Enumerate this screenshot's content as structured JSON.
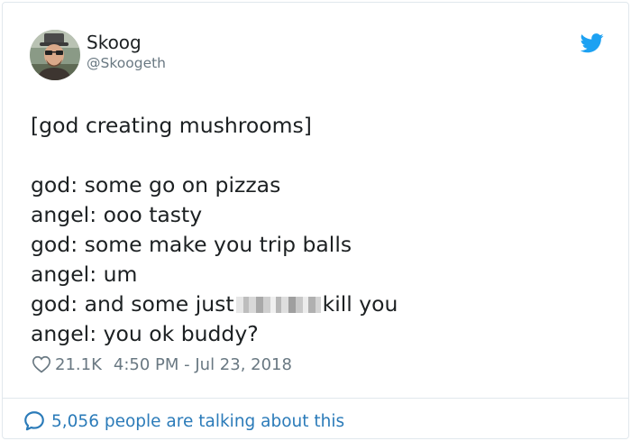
{
  "tweet": {
    "author": {
      "display_name": "Skoog",
      "handle": "@Skoogeth",
      "avatar_icon": "avatar-photo"
    },
    "brand_icon": "twitter-bird-icon",
    "brand_color": "#1da1f2",
    "text_lines": [
      "[god creating mushrooms]",
      "",
      "god: some go on pizzas",
      "angel: ooo tasty",
      "god: some make you trip balls",
      "angel: um",
      {
        "before": "god: and some just ",
        "after": " kill you"
      },
      "angel: you ok buddy?"
    ],
    "line1": "[god creating mushrooms]",
    "line3": "god: some go on pizzas",
    "line4": "angel: ooo tasty",
    "line5": "god: some make you trip balls",
    "line6": "angel: um",
    "line7_before": "god: and some just",
    "line7_after": "kill you",
    "line8": "angel: you ok buddy?",
    "likes": "21.1K",
    "timestamp": "4:50 PM - Jul 23, 2018",
    "talking_label": "5,056 people are talking about this",
    "link_color": "#2b7bb9",
    "muted_color": "#697882"
  }
}
